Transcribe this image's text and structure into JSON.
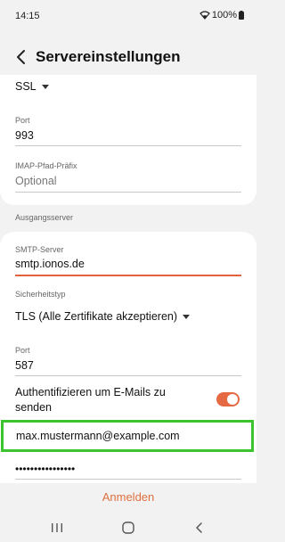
{
  "status": {
    "time": "14:15",
    "battery": "100%"
  },
  "header": {
    "title": "Servereinstellungen"
  },
  "incoming": {
    "security_value": "SSL",
    "port_label": "Port",
    "port_value": "993",
    "imap_prefix_label": "IMAP-Pfad-Präfix",
    "imap_prefix_placeholder": "Optional"
  },
  "outgoing": {
    "section_label": "Ausgangsserver",
    "smtp_label": "SMTP-Server",
    "smtp_value": "smtp.ionos.de",
    "security_label": "Sicherheitstyp",
    "security_value": "TLS (Alle Zertifikate akzeptieren)",
    "port_label": "Port",
    "port_value": "587",
    "auth_label": "Authentifizieren um E-Mails zu senden",
    "auth_enabled": true,
    "username_value": "max.mustermann@example.com",
    "password_value": "••••••••••••••••"
  },
  "footer": {
    "action_label": "Anmelden"
  },
  "colors": {
    "accent": "#e56a43",
    "highlight": "#3cc42e"
  }
}
